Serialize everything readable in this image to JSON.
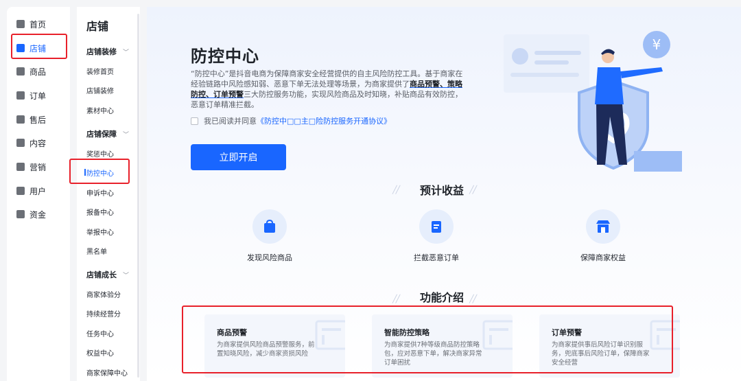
{
  "nav_primary": [
    {
      "label": "首页",
      "icon": "home-icon"
    },
    {
      "label": "店铺",
      "icon": "store-icon",
      "active": true
    },
    {
      "label": "商品",
      "icon": "product-icon"
    },
    {
      "label": "订单",
      "icon": "order-icon"
    },
    {
      "label": "售后",
      "icon": "after-sales-icon"
    },
    {
      "label": "内容",
      "icon": "content-icon"
    },
    {
      "label": "营销",
      "icon": "megaphone-icon"
    },
    {
      "label": "用户",
      "icon": "user-icon"
    },
    {
      "label": "资金",
      "icon": "wallet-icon"
    }
  ],
  "nav_secondary": {
    "title": "店铺",
    "groups": [
      {
        "label": "店铺装修",
        "items": [
          "装修首页",
          "店铺装修",
          "素材中心"
        ]
      },
      {
        "label": "店铺保障",
        "items": [
          "奖惩中心",
          "防控中心",
          "申诉中心",
          "报备中心",
          "举报中心",
          "黑名单"
        ]
      },
      {
        "label": "店铺成长",
        "items": [
          "商家体验分",
          "持续经营分",
          "任务中心",
          "权益中心",
          "商家保障中心"
        ]
      }
    ],
    "active_item": "防控中心"
  },
  "hero": {
    "title": "防控中心",
    "desc_prefix": "“防控中心”是抖音电商为保障商家安全经营提供的自主风险防控工具。基于商家在经验链路中风险感知弱、恶意下单无法处理等场景，为商家提供了",
    "desc_highlight": "商品预警、策略防控、订单预警",
    "desc_suffix": "三大防控服务功能，实现风险商品及时知晓，补贴商品有效防控，恶意订单精准拦截。",
    "agree_text": "我已阅读并同意",
    "agree_link": "《防控中□□主□险防控服务开通协议》",
    "button": "立即开启"
  },
  "benefits": {
    "title": "预计收益",
    "items": [
      {
        "label": "发现风险商品",
        "icon": "bag-icon"
      },
      {
        "label": "拦截恶意订单",
        "icon": "clipboard-icon"
      },
      {
        "label": "保障商家权益",
        "icon": "shop-shield-icon"
      }
    ]
  },
  "features": {
    "title": "功能介绍",
    "items": [
      {
        "title": "商品预警",
        "desc": "为商家提供风险商品预警服务，前置知晓风险，减少商家资损风险"
      },
      {
        "title": "智能防控策略",
        "desc": "为商家提供7种等级商品防控策略包，应对恶意下单，解决商家异常订单困扰"
      },
      {
        "title": "订单预警",
        "desc": "为商家提供事后风险订单识别服务，兜底事后风险订单，保障商家安全经营"
      }
    ]
  },
  "colors": {
    "accent": "#1966ff",
    "highlight_box": "#e8202a"
  }
}
